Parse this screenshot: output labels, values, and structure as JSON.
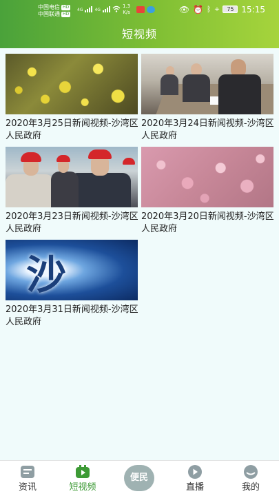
{
  "status_bar": {
    "carrier1": "中国电信",
    "carrier2": "中国联通",
    "hd": "HD",
    "net1": "4G",
    "net2": "4G",
    "speed_value": "1.3",
    "speed_unit": "K/s",
    "battery": "75",
    "time": "15:15"
  },
  "header": {
    "title": "短视频"
  },
  "videos": [
    {
      "title": "2020年3月25日新闻视频-沙湾区人民政府"
    },
    {
      "title": "2020年3月24日新闻视频-沙湾区人民政府"
    },
    {
      "title": "2020年3月23日新闻视频-沙湾区人民政府"
    },
    {
      "title": "2020年3月20日新闻视频-沙湾区人民政府"
    },
    {
      "title": "2020年3月31日新闻视频-沙湾区人民政府",
      "thumb_text": "沙"
    }
  ],
  "nav": {
    "items": [
      {
        "label": "资讯",
        "icon": "news-icon"
      },
      {
        "label": "短视频",
        "icon": "video-icon"
      },
      {
        "label": "便民",
        "icon": "service-icon"
      },
      {
        "label": "直播",
        "icon": "live-icon"
      },
      {
        "label": "我的",
        "icon": "profile-icon"
      }
    ],
    "active_color": "#3d9a35"
  },
  "colors": {
    "header_start": "#4aa23a",
    "header_end": "#a6d43c",
    "background": "#f0fbfb"
  }
}
